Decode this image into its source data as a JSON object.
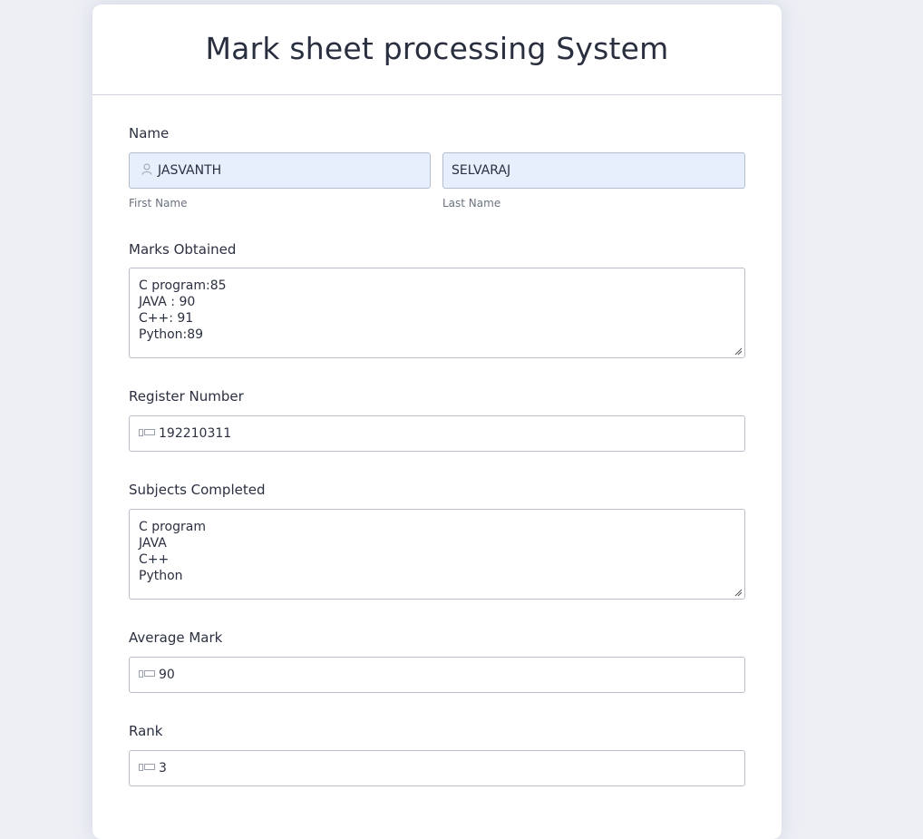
{
  "form": {
    "title": "Mark sheet processing System",
    "name_label": "Name",
    "first_name": {
      "value": "JASVANTH",
      "sublabel": "First Name"
    },
    "last_name": {
      "value": "SELVARAJ",
      "sublabel": "Last Name"
    },
    "marks_label": "Marks Obtained",
    "marks_lines": [
      "C program:85",
      "JAVA : 90",
      "C++: 91",
      "Python:89"
    ],
    "register_label": "Register Number",
    "register_value": "192210311",
    "subjects_label": "Subjects Completed",
    "subjects_lines": [
      "C program",
      "JAVA",
      "C++",
      "Python"
    ],
    "average_label": "Average Mark",
    "average_value": "90",
    "rank_label": "Rank",
    "rank_value": "3"
  },
  "icons": {
    "person": "person-icon",
    "id_card": "id-card-icon"
  },
  "colors": {
    "background": "#edeff5",
    "autofill": "#e8effc",
    "text": "#2b3040",
    "border": "#b9bdc8"
  }
}
